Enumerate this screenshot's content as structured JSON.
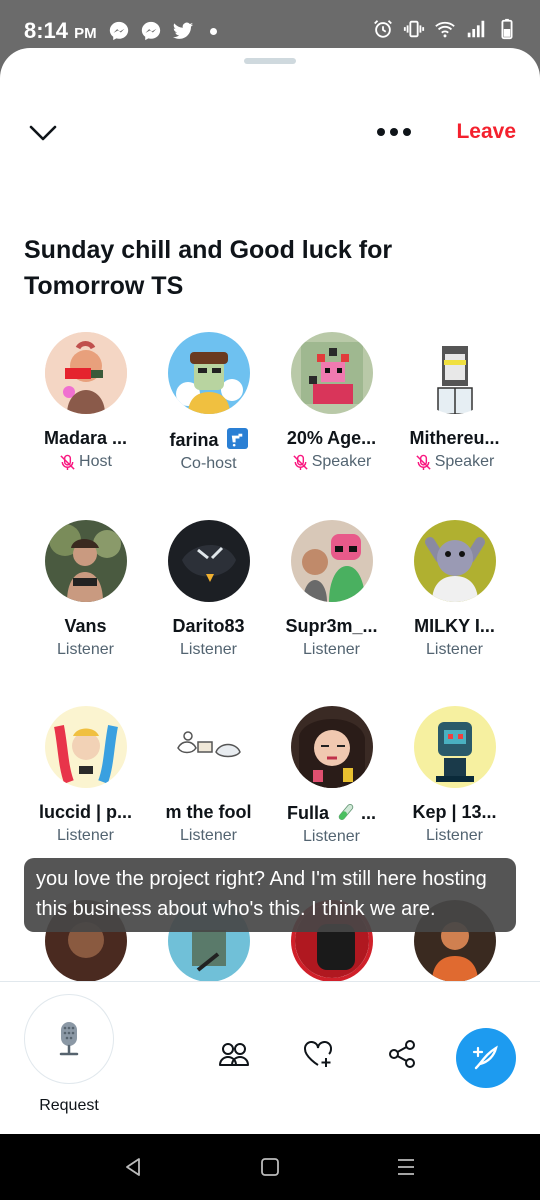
{
  "status_bar": {
    "time": "8:14",
    "ampm": "PM",
    "left_icons": [
      "messenger-icon",
      "messenger-icon",
      "twitter-icon",
      "dot-icon"
    ],
    "right_icons": [
      "alarm-icon",
      "vibrate-icon",
      "wifi-icon",
      "signal-icon",
      "battery-icon"
    ]
  },
  "header": {
    "collapse_icon": "chevron-down-icon",
    "more_icon": "more-dots-icon",
    "leave_label": "Leave",
    "accent_color": "#f4212e"
  },
  "space": {
    "title": "Sunday chill and Good luck for Tomorrow TS"
  },
  "participants": [
    {
      "name": "Madara ...",
      "role": "Host",
      "muted": true,
      "badge": ""
    },
    {
      "name": "farina",
      "role": "Co-host",
      "muted": false,
      "badge": "faucet-emoji"
    },
    {
      "name": "20% Age...",
      "role": "Speaker",
      "muted": true,
      "badge": ""
    },
    {
      "name": "Mithereu...",
      "role": "Speaker",
      "muted": true,
      "badge": ""
    },
    {
      "name": "Vans",
      "role": "Listener",
      "muted": false,
      "badge": ""
    },
    {
      "name": "Darito83",
      "role": "Listener",
      "muted": false,
      "badge": ""
    },
    {
      "name": "Supr3m_...",
      "role": "Listener",
      "muted": false,
      "badge": ""
    },
    {
      "name": "MILKY I...",
      "role": "Listener",
      "muted": false,
      "badge": ""
    },
    {
      "name": "luccid | p...",
      "role": "Listener",
      "muted": false,
      "badge": ""
    },
    {
      "name": "m the fool",
      "role": "Listener",
      "muted": false,
      "badge": ""
    },
    {
      "name": "Fulla",
      "role": "Listener",
      "muted": false,
      "badge": "test-tube-emoji",
      "suffix": "..."
    },
    {
      "name": "Kep | 13...",
      "role": "Listener",
      "muted": false,
      "badge": ""
    }
  ],
  "caption": {
    "text": "you love the project right? And I'm still here hosting this business about who's this. I think we are."
  },
  "footer": {
    "request_label": "Request",
    "icons": [
      "people-icon",
      "heart-plus-icon",
      "share-icon",
      "compose-icon"
    ],
    "fab_color": "#1d9bf0"
  },
  "nav_bar": {
    "icons": [
      "back-triangle-icon",
      "home-square-icon",
      "recents-lines-icon"
    ]
  }
}
